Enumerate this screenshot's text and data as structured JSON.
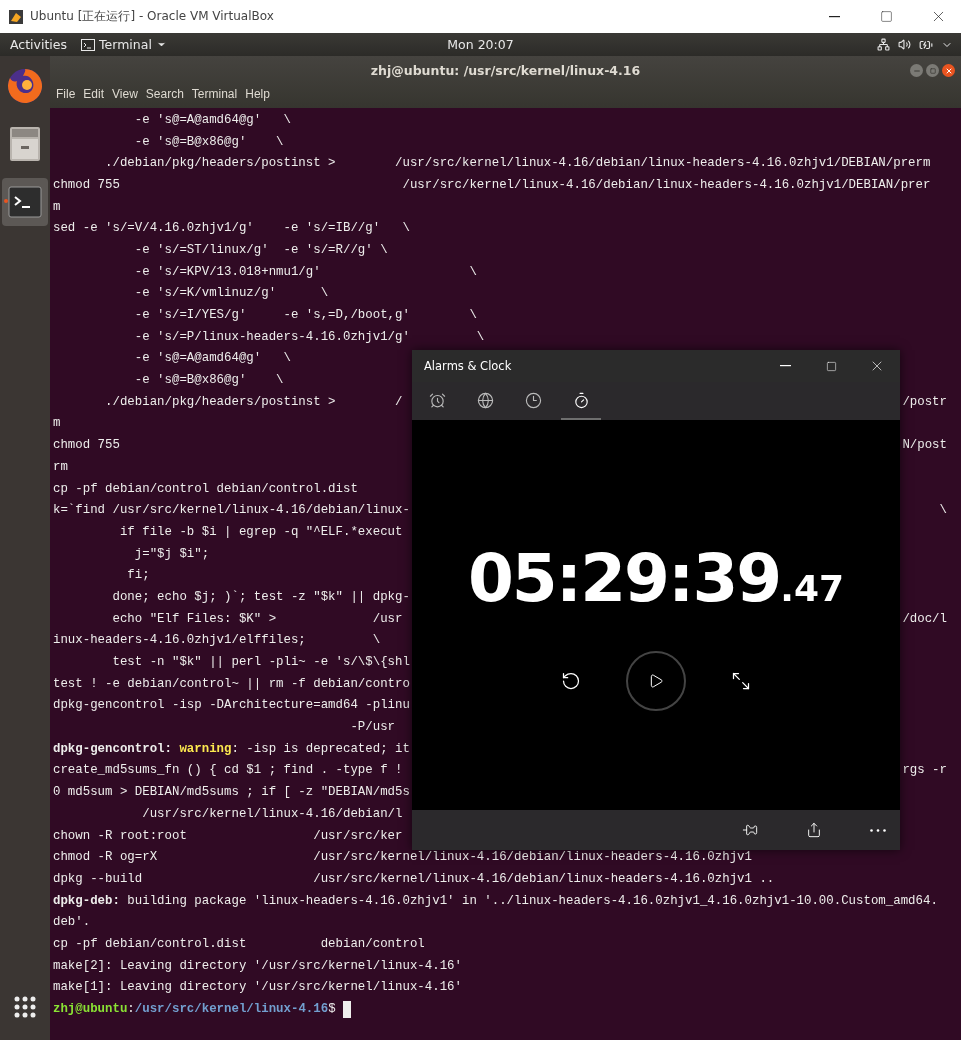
{
  "host_window": {
    "title": "Ubuntu [正在运行] - Oracle VM VirtualBox"
  },
  "top_bar": {
    "activities": "Activities",
    "app_menu": "Terminal",
    "clock": "Mon 20:07"
  },
  "dock": {
    "items": [
      {
        "kind": "browser",
        "selected": false
      },
      {
        "kind": "files",
        "selected": false
      },
      {
        "kind": "terminal",
        "selected": true
      }
    ]
  },
  "terminal": {
    "title": "zhj@ubuntu: /usr/src/kernel/linux-4.16",
    "menu": [
      "File",
      "Edit",
      "View",
      "Search",
      "Terminal",
      "Help"
    ],
    "lines": [
      {
        "text": "           -e 's@=A@amd64@g'   \\"
      },
      {
        "text": "           -e 's@=B@x86@g'    \\"
      },
      {
        "text": "       ./debian/pkg/headers/postinst >        /usr/src/kernel/linux-4.16/debian/linux-headers-4.16.0zhjv1/DEBIAN/prerm"
      },
      {
        "text": "chmod 755                                      /usr/src/kernel/linux-4.16/debian/linux-headers-4.16.0zhjv1/DEBIAN/prer"
      },
      {
        "text": "m"
      },
      {
        "text": "sed -e 's/=V/4.16.0zhjv1/g'    -e 's/=IB//g'   \\"
      },
      {
        "text": "           -e 's/=ST/linux/g'  -e 's/=R//g' \\"
      },
      {
        "text": "           -e 's/=KPV/13.018+nmu1/g'                    \\"
      },
      {
        "text": "           -e 's/=K/vmlinuz/g'      \\"
      },
      {
        "text": "           -e 's/=I/YES/g'     -e 's,=D,/boot,g'        \\"
      },
      {
        "text": "           -e 's/=P/linux-headers-4.16.0zhjv1/g'         \\"
      },
      {
        "text": "           -e 's@=A@amd64@g'   \\"
      },
      {
        "text": "           -e 's@=B@x86@g'    \\"
      },
      {
        "text": "       ./debian/pkg/headers/postinst >        /",
        "tail": "/postr"
      },
      {
        "text": "m"
      },
      {
        "text": "chmod 755",
        "tail": "N/post"
      },
      {
        "text": "rm"
      },
      {
        "text": "cp -pf debian/control debian/control.dist"
      },
      {
        "text": "k=`find /usr/src/kernel/linux-4.16/debian/linux-",
        "tail": "\\"
      },
      {
        "text": "         if file -b $i | egrep -q \"^ELF.*execut"
      },
      {
        "text": "           j=\"$j $i\";"
      },
      {
        "text": "          fi;"
      },
      {
        "text": "        done; echo $j; )`; test -z \"$k\" || dpkg-"
      },
      {
        "text": "        echo \"Elf Files: $K\" >             /usr",
        "tail": "/doc/l"
      },
      {
        "text": "inux-headers-4.16.0zhjv1/elffiles;         \\"
      },
      {
        "text": "        test -n \"$k\" || perl -pli~ -e 's/\\$\\{shl"
      },
      {
        "text": "test ! -e debian/control~ || rm -f debian/contro"
      },
      {
        "text": "dpkg-gencontrol -isp -DArchitecture=amd64 -plinu"
      },
      {
        "text": "                                        -P/usr"
      },
      {
        "parts": [
          {
            "kind": "bold",
            "text": "dpkg-gencontrol: "
          },
          {
            "kind": "warning",
            "text": "warning"
          },
          {
            "kind": "plain",
            "text": ": -isp is deprecated; it"
          }
        ]
      },
      {
        "text": "create_md5sums_fn () { cd $1 ; find . -type f ! ",
        "tail": "rgs -r"
      },
      {
        "text": "0 md5sum > DEBIAN/md5sums ; if [ -z \"DEBIAN/md5s"
      },
      {
        "text": "            /usr/src/kernel/linux-4.16/debian/l"
      },
      {
        "text": "chown -R root:root                 /usr/src/ker"
      },
      {
        "text": "chmod -R og=rX                     /usr/src/kernel/linux-4.16/debian/linux-headers-4.16.0zhjv1"
      },
      {
        "text": "dpkg --build                       /usr/src/kernel/linux-4.16/debian/linux-headers-4.16.0zhjv1 .."
      },
      {
        "parts": [
          {
            "kind": "bold",
            "text": "dpkg-deb:"
          },
          {
            "kind": "plain",
            "text": " building package 'linux-headers-4.16.0zhjv1' in '../linux-headers-4.16.0zhjv1_4.16.0zhjv1-10.00.Custom_amd64."
          }
        ]
      },
      {
        "text": "deb'."
      },
      {
        "text": "cp -pf debian/control.dist          debian/control"
      },
      {
        "text": "make[2]: Leaving directory '/usr/src/kernel/linux-4.16'"
      },
      {
        "text": "make[1]: Leaving directory '/usr/src/kernel/linux-4.16'"
      },
      {
        "parts": [
          {
            "kind": "user",
            "text": "zhj@ubuntu"
          },
          {
            "kind": "plain",
            "text": ":"
          },
          {
            "kind": "path",
            "text": "/usr/src/kernel/linux-4.16"
          },
          {
            "kind": "plain",
            "text": "$ "
          }
        ],
        "cursor": true
      }
    ]
  },
  "clock_app": {
    "title": "Alarms & Clock",
    "tabs": [
      {
        "kind": "alarm",
        "selected": false
      },
      {
        "kind": "world-clock",
        "selected": false
      },
      {
        "kind": "timer",
        "selected": false
      },
      {
        "kind": "stopwatch",
        "selected": true
      }
    ],
    "time": "05:29:39",
    "fraction": ".47"
  }
}
